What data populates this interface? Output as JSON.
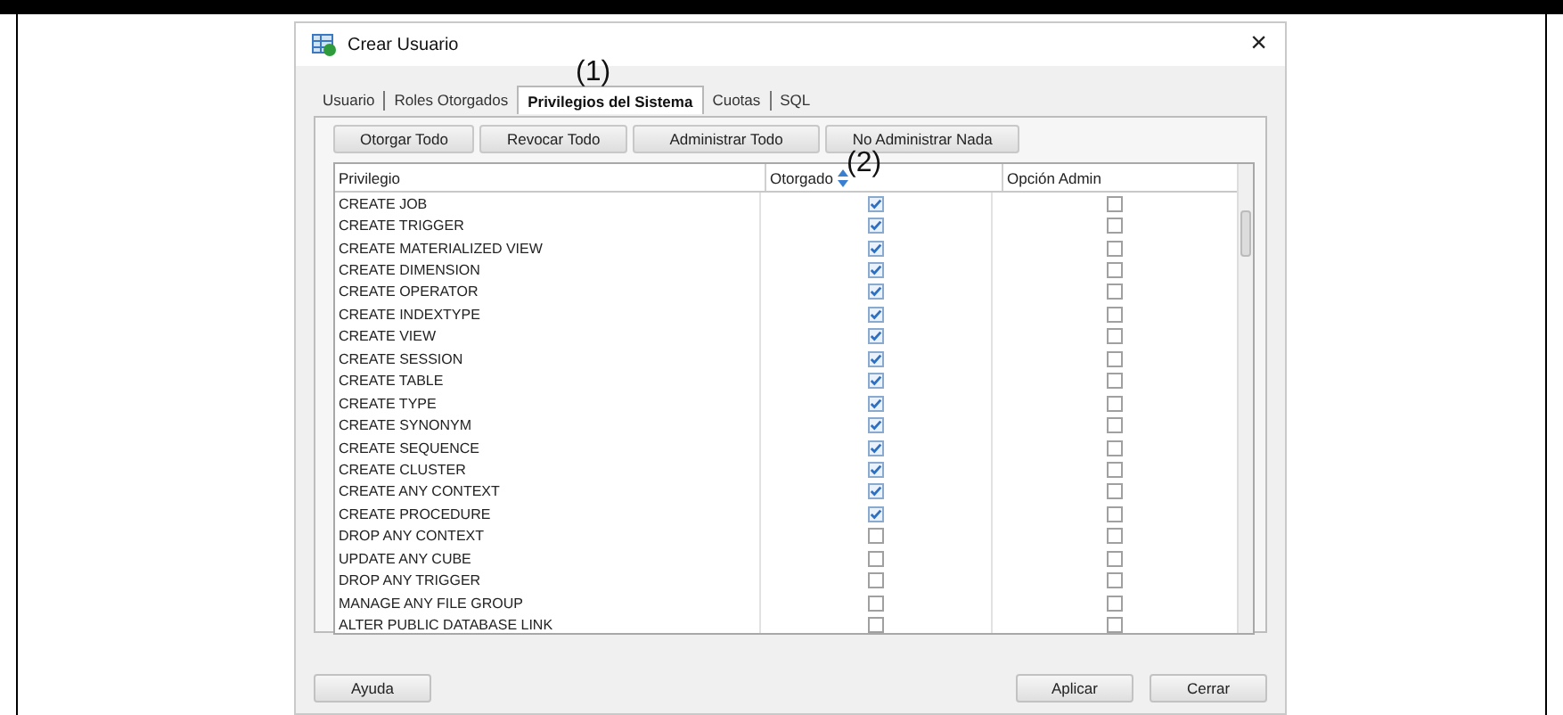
{
  "window": {
    "title": "Crear Usuario",
    "close": "×"
  },
  "tabs": [
    {
      "label": "Usuario",
      "selected": false
    },
    {
      "label": "Roles Otorgados",
      "selected": false
    },
    {
      "label": "Privilegios del Sistema",
      "selected": true
    },
    {
      "label": "Cuotas",
      "selected": false
    },
    {
      "label": "SQL",
      "selected": false
    }
  ],
  "toolbar": [
    "Otorgar Todo",
    "Revocar Todo",
    "Administrar Todo",
    "No Administrar Nada"
  ],
  "annotations": [
    "(1)",
    "(2)"
  ],
  "table": {
    "columns": [
      "Privilegio",
      "Otorgado",
      "Opción Admin"
    ],
    "rows": [
      {
        "name": "CREATE JOB",
        "granted": true,
        "admin": false
      },
      {
        "name": "CREATE TRIGGER",
        "granted": true,
        "admin": false
      },
      {
        "name": "CREATE MATERIALIZED VIEW",
        "granted": true,
        "admin": false
      },
      {
        "name": "CREATE DIMENSION",
        "granted": true,
        "admin": false
      },
      {
        "name": "CREATE OPERATOR",
        "granted": true,
        "admin": false
      },
      {
        "name": "CREATE INDEXTYPE",
        "granted": true,
        "admin": false
      },
      {
        "name": "CREATE VIEW",
        "granted": true,
        "admin": false
      },
      {
        "name": "CREATE SESSION",
        "granted": true,
        "admin": false
      },
      {
        "name": "CREATE TABLE",
        "granted": true,
        "admin": false
      },
      {
        "name": "CREATE TYPE",
        "granted": true,
        "admin": false
      },
      {
        "name": "CREATE SYNONYM",
        "granted": true,
        "admin": false
      },
      {
        "name": "CREATE SEQUENCE",
        "granted": true,
        "admin": false
      },
      {
        "name": "CREATE CLUSTER",
        "granted": true,
        "admin": false
      },
      {
        "name": "CREATE ANY CONTEXT",
        "granted": true,
        "admin": false
      },
      {
        "name": "CREATE PROCEDURE",
        "granted": true,
        "admin": false
      },
      {
        "name": "DROP ANY CONTEXT",
        "granted": false,
        "admin": false
      },
      {
        "name": "UPDATE ANY CUBE",
        "granted": false,
        "admin": false
      },
      {
        "name": "DROP ANY TRIGGER",
        "granted": false,
        "admin": false
      },
      {
        "name": "MANAGE ANY FILE GROUP",
        "granted": false,
        "admin": false
      },
      {
        "name": "ALTER PUBLIC DATABASE LINK",
        "granted": false,
        "admin": false
      }
    ]
  },
  "footer": {
    "left": [
      "Ayuda"
    ],
    "right": [
      "Aplicar",
      "Cerrar"
    ]
  }
}
